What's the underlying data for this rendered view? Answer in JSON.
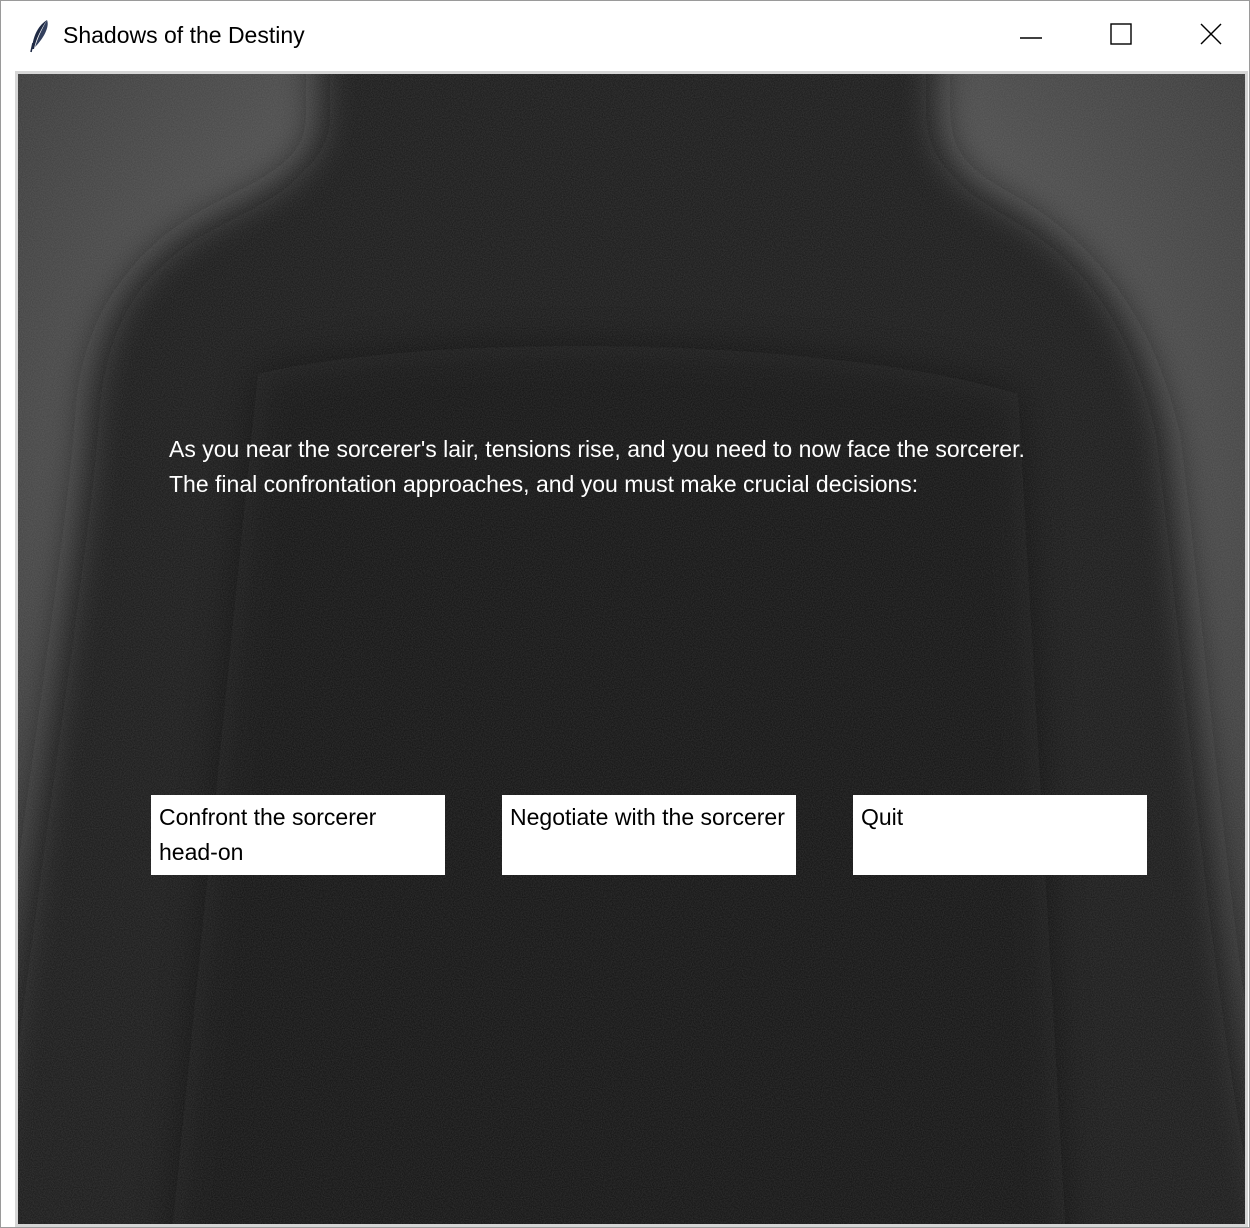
{
  "window": {
    "title": "Shadows of the Destiny",
    "app_icon": "feather-icon",
    "controls": {
      "minimize_icon": "minimize-icon",
      "maximize_icon": "maximize-icon",
      "close_icon": "close-icon"
    }
  },
  "scene": {
    "background": "dark-silhouette-figure",
    "narration": "As you near the sorcerer's lair, tensions rise, and you need to now face the sorcerer. The final confrontation approaches, and you must make crucial decisions:",
    "choices": [
      {
        "label": "Confront the sorcerer head-on"
      },
      {
        "label": "Negotiate with the sorcerer"
      },
      {
        "label": "Quit"
      }
    ]
  },
  "colors": {
    "text_on_dark": "#ffffff",
    "button_bg": "#ffffff",
    "button_text": "#000000",
    "backdrop_dark": "#161616",
    "backdrop_light": "#6a6a6a"
  }
}
